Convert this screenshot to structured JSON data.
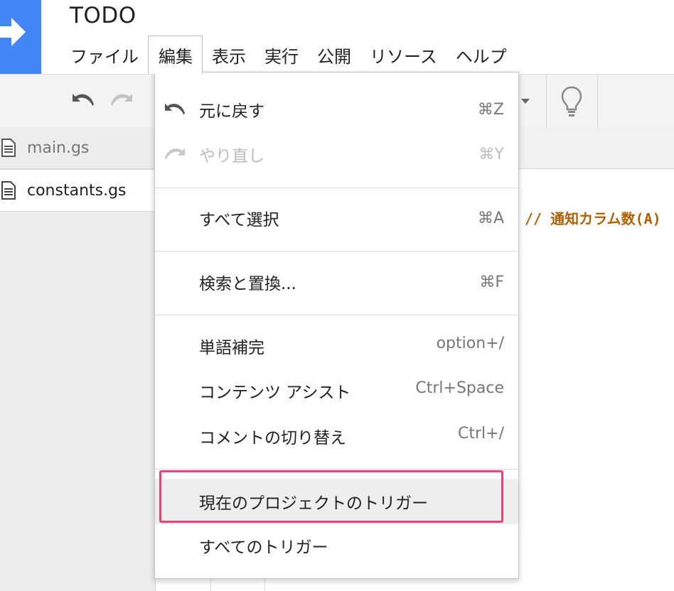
{
  "app": {
    "title": "TODO"
  },
  "menubar": {
    "items": [
      {
        "label": "ファイル"
      },
      {
        "label": "編集"
      },
      {
        "label": "表示"
      },
      {
        "label": "実行"
      },
      {
        "label": "公開"
      },
      {
        "label": "リソース"
      },
      {
        "label": "ヘルプ"
      }
    ],
    "active": "編集"
  },
  "files": [
    {
      "name": "main.gs"
    },
    {
      "name": "constants.gs"
    }
  ],
  "editor": {
    "visible_code": "// 通知カラム数(A)"
  },
  "edit_menu": {
    "items": [
      {
        "label": "元に戻す",
        "shortcut": "⌘Z",
        "icon": "undo-icon"
      },
      {
        "label": "やり直し",
        "shortcut": "⌘Y",
        "icon": "redo-icon",
        "disabled": true
      },
      {
        "label": "すべて選択",
        "shortcut": "⌘A"
      },
      {
        "label": "検索と置換...",
        "shortcut": "⌘F"
      },
      {
        "label": "単語補完",
        "shortcut": "option+/"
      },
      {
        "label": "コンテンツ アシスト",
        "shortcut": "Ctrl+Space"
      },
      {
        "label": "コメントの切り替え",
        "shortcut": "Ctrl+/"
      },
      {
        "label": "現在のプロジェクトのトリガー",
        "highlighted": true
      },
      {
        "label": "すべてのトリガー"
      }
    ]
  },
  "colors": {
    "brand": "#4285f4",
    "highlight_outline": "#ef3f78",
    "code_comment": "#b35f00"
  }
}
